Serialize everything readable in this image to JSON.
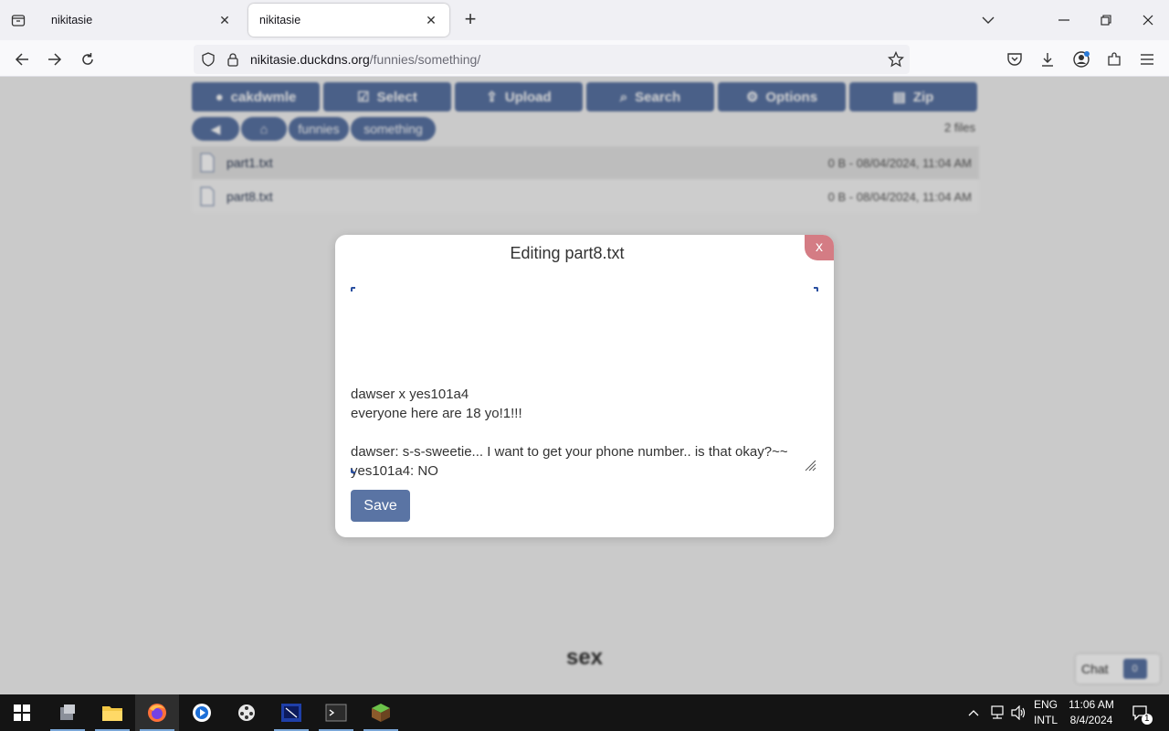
{
  "browser": {
    "tabs": [
      {
        "title": "nikitasie",
        "active": false
      },
      {
        "title": "nikitasie",
        "active": true
      }
    ],
    "url_host": "nikitasie.duckdns.org",
    "url_path": "/funnies/something/"
  },
  "page": {
    "toolbar": {
      "user": "cakdwmle",
      "select": "Select",
      "upload": "Upload",
      "search": "Search",
      "options": "Options",
      "zip": "Zip"
    },
    "breadcrumb": [
      "funnies",
      "something"
    ],
    "file_count": "2 files",
    "files": [
      {
        "name": "part1.txt",
        "meta": "0 B - 08/04/2024, 11:04 AM"
      },
      {
        "name": "part8.txt",
        "meta": "0 B - 08/04/2024, 11:04 AM"
      }
    ],
    "footer": "sex",
    "chat_label": "Chat",
    "chat_badge": "0"
  },
  "modal": {
    "title": "Editing part8.txt",
    "close_label": "x",
    "content": "dawser x yes101a4\neveryone here are 18 yo!1!!!\n\ndawser: s-s-sweetie... I want to get your phone number.. is that okay?~~\nyes101a4: NO",
    "save_label": "Save"
  },
  "taskbar": {
    "language": "ENG",
    "layout": "INTL",
    "time": "11:06 AM",
    "date": "8/4/2024",
    "notification_count": "1"
  },
  "colors": {
    "accent": "#5a74a4",
    "close": "#d47c84"
  }
}
